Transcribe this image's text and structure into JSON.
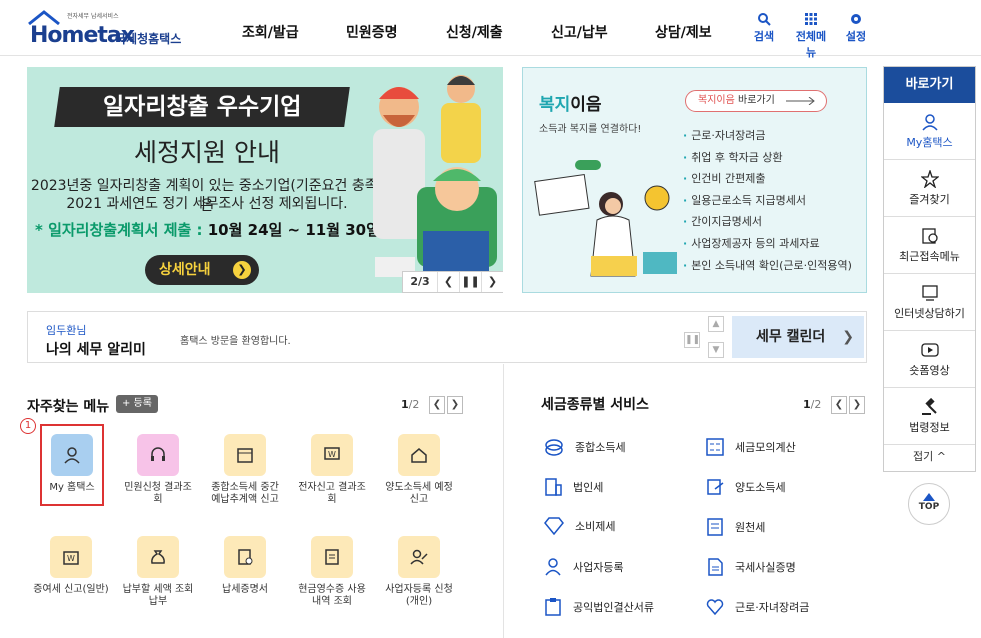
{
  "header": {
    "logo_small": "전자세무 납세서비스",
    "logo_main": "Hometax",
    "logo_sub": "국세청홈택스",
    "nav": [
      "조회/발급",
      "민원증명",
      "신청/제출",
      "신고/납부",
      "상담/제보"
    ],
    "utils": [
      {
        "label": "검색",
        "icon": "search-icon"
      },
      {
        "label": "전체메뉴",
        "icon": "grid-icon"
      },
      {
        "label": "설정",
        "icon": "gear-icon"
      }
    ]
  },
  "banner": {
    "title": "일자리창출 우수기업",
    "subtitle": "세정지원 안내",
    "line1": "2023년중 일자리창출 계획이 있는 중소기업(기준요건 충족)은",
    "line2": "2021 과세연도 정기 세무조사 선정 제외됩니다.",
    "highlight_label": "* 일자리창출계획서 제출 :",
    "highlight_date": "10월 24일 ~ 11월 30일",
    "button": "상세안내",
    "page": "2/3",
    "bg_color": "#bfe9dd"
  },
  "welfare": {
    "title_a": "복지",
    "title_b": "이음",
    "desc": "소득과 복지를 연결하다!",
    "button_a": "복지이음",
    "button_b": "바로가기",
    "items": [
      "근로·자녀장려금",
      "취업 후 학자금 상환",
      "인건비 간편제출",
      "일용근로소득 지급명세서",
      "간이지급명세서",
      "사업장제공자 등의 과세자료",
      "본인 소득내역 확인(근로·인적용역)"
    ],
    "accent": "#1fa6b0"
  },
  "notice": {
    "user": "임두환님",
    "title": "나의 세무 알리미",
    "message": "홈택스 방문을 환영합니다.",
    "calendar": "세무 캘린더"
  },
  "freq": {
    "title": "자주찾는 메뉴",
    "add": "+ 등록",
    "page_cur": "1",
    "page_total": "/2",
    "marker": "1",
    "items": [
      {
        "label": "My 홈택스",
        "icon": "user-icon"
      },
      {
        "label": "민원신청 결과조회",
        "icon": "headset-icon"
      },
      {
        "label": "종합소득세 중간예납추계액 신고",
        "icon": "calendar-icon"
      },
      {
        "label": "전자신고 결과조회",
        "icon": "monitor-won-icon"
      },
      {
        "label": "양도소득세 예정신고",
        "icon": "house-icon"
      },
      {
        "label": "증여세 신고(일반)",
        "icon": "gift-won-icon"
      },
      {
        "label": "납부할 세액 조회납부",
        "icon": "moneybag-icon"
      },
      {
        "label": "납세증명서",
        "icon": "certificate-icon"
      },
      {
        "label": "현금영수증 사용내역 조회",
        "icon": "receipt-icon"
      },
      {
        "label": "사업자등록 신청(개인)",
        "icon": "user-edit-icon"
      }
    ]
  },
  "tax_service": {
    "title": "세금종류별 서비스",
    "page_cur": "1",
    "page_total": "/2",
    "items": [
      {
        "label": "종합소득세",
        "icon": "coins-icon"
      },
      {
        "label": "세금모의계산",
        "icon": "calculator-icon"
      },
      {
        "label": "법인세",
        "icon": "building-icon"
      },
      {
        "label": "양도소득세",
        "icon": "transfer-icon"
      },
      {
        "label": "소비제세",
        "icon": "diamond-icon"
      },
      {
        "label": "원천세",
        "icon": "payslip-icon"
      },
      {
        "label": "사업자등록",
        "icon": "person-icon"
      },
      {
        "label": "국세사실증명",
        "icon": "document-icon"
      },
      {
        "label": "공익법인결산서류",
        "icon": "clipboard-icon"
      },
      {
        "label": "근로·자녀장려금",
        "icon": "heart-hand-icon"
      }
    ]
  },
  "sidebar": {
    "title": "바로가기",
    "items": [
      {
        "label": "My홈택스",
        "icon": "user-icon"
      },
      {
        "label": "즐겨찾기",
        "icon": "star-icon"
      },
      {
        "label": "최근접속메뉴",
        "icon": "recent-icon"
      },
      {
        "label": "인터넷상담하기",
        "icon": "chat-monitor-icon"
      },
      {
        "label": "숏폼영상",
        "icon": "play-icon"
      },
      {
        "label": "법령정보",
        "icon": "gavel-icon"
      }
    ],
    "fold": "접기",
    "top": "TOP",
    "accent": "#1b4d9c"
  }
}
